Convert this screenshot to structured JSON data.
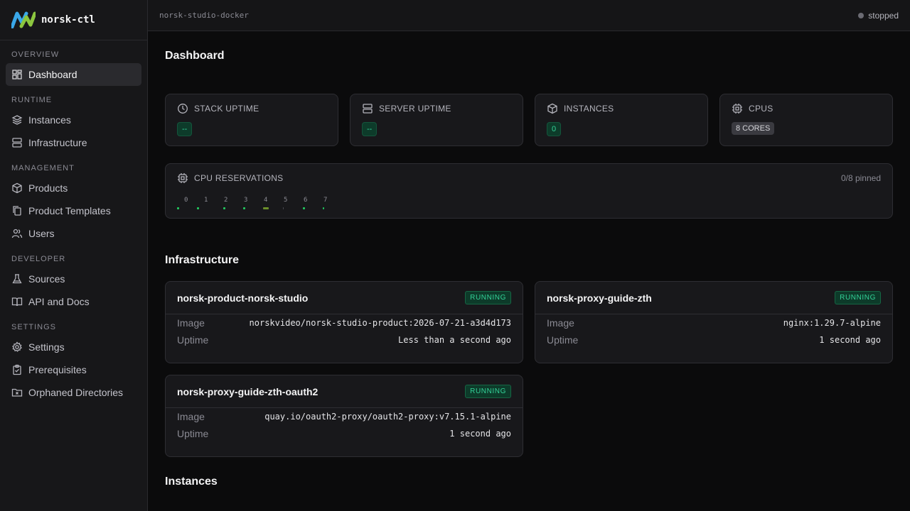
{
  "app": {
    "name": "norsk-ctl",
    "env": "norsk-studio-docker",
    "status": "stopped"
  },
  "sidebar": {
    "sections": [
      {
        "title": "OVERVIEW",
        "items": [
          {
            "label": "Dashboard",
            "icon": "dashboard-icon",
            "active": true
          }
        ]
      },
      {
        "title": "RUNTIME",
        "items": [
          {
            "label": "Instances",
            "icon": "layers-icon"
          },
          {
            "label": "Infrastructure",
            "icon": "server-icon"
          }
        ]
      },
      {
        "title": "MANAGEMENT",
        "items": [
          {
            "label": "Products",
            "icon": "package-icon"
          },
          {
            "label": "Product Templates",
            "icon": "copy-icon"
          },
          {
            "label": "Users",
            "icon": "users-icon"
          }
        ]
      },
      {
        "title": "DEVELOPER",
        "items": [
          {
            "label": "Sources",
            "icon": "flask-icon"
          },
          {
            "label": "API and Docs",
            "icon": "book-icon"
          }
        ]
      },
      {
        "title": "SETTINGS",
        "items": [
          {
            "label": "Settings",
            "icon": "gear-icon"
          },
          {
            "label": "Prerequisites",
            "icon": "clipboard-check-icon"
          },
          {
            "label": "Orphaned Directories",
            "icon": "folder-x-icon"
          }
        ]
      }
    ]
  },
  "dashboard": {
    "title": "Dashboard",
    "stats": [
      {
        "label": "STACK UPTIME",
        "value": "--",
        "icon": "clock-icon"
      },
      {
        "label": "SERVER UPTIME",
        "value": "--",
        "icon": "server-icon"
      },
      {
        "label": "INSTANCES",
        "value": "0",
        "icon": "cube-icon"
      },
      {
        "label": "CPUS",
        "value": "8 CORES",
        "icon": "cpu-icon"
      }
    ],
    "cpu_reservations": {
      "label": "CPU RESERVATIONS",
      "pinned": "0/8 pinned",
      "cores": [
        "0",
        "1",
        "2",
        "3",
        "4",
        "5",
        "6",
        "7"
      ]
    }
  },
  "infrastructure": {
    "title": "Infrastructure",
    "image_label": "Image",
    "uptime_label": "Uptime",
    "items": [
      {
        "name": "norsk-product-norsk-studio",
        "status": "RUNNING",
        "image": "norskvideo/norsk-studio-product:2026-07-21-a3d4d173",
        "uptime": "Less than a second ago"
      },
      {
        "name": "norsk-proxy-guide-zth",
        "status": "RUNNING",
        "image": "nginx:1.29.7-alpine",
        "uptime": "1 second ago"
      },
      {
        "name": "norsk-proxy-guide-zth-oauth2",
        "status": "RUNNING",
        "image": "quay.io/oauth2-proxy/oauth2-proxy:v7.15.1-alpine",
        "uptime": "1 second ago"
      }
    ]
  },
  "instances": {
    "title": "Instances"
  },
  "colors": {
    "accent_green": "#34d399",
    "logo_blue": "#3aa7e8",
    "logo_green": "#8cc63f"
  }
}
